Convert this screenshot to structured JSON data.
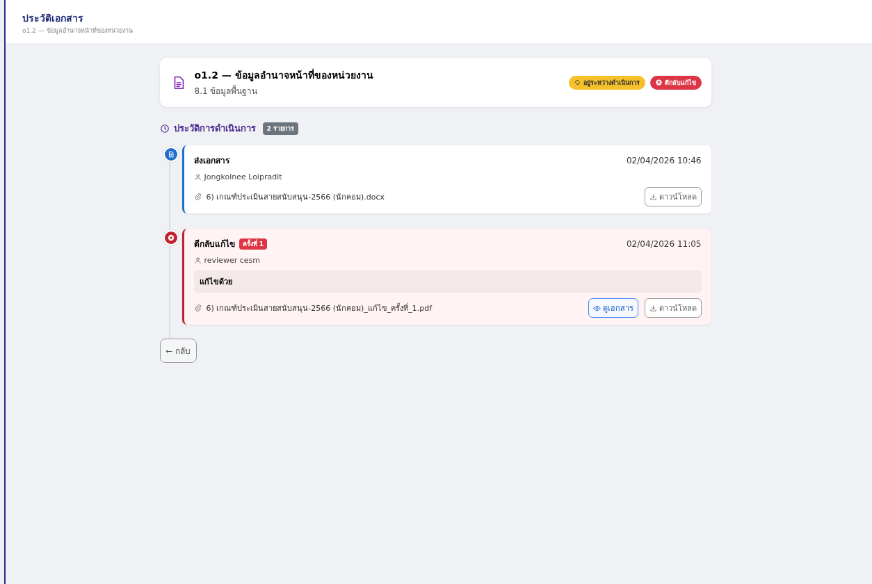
{
  "header": {
    "title": "ประวัติเอกสาร",
    "subtitle": "o1.2 — ข้อมูลอำนาจหน้าที่ของหน่วยงาน"
  },
  "document": {
    "title": "o1.2 — ข้อมูลอำนาจหน้าที่ของหน่วยงาน",
    "category": "8.1 ข้อมูลพื้นฐาน",
    "badges": [
      {
        "kind": "pending",
        "label": "อยู่ระหว่างดำเนินการ"
      },
      {
        "kind": "returned",
        "label": "ตีกลับแก้ไข"
      }
    ]
  },
  "history": {
    "title": "ประวัติการดำเนินการ",
    "count": "2 รายการ",
    "entries": [
      {
        "kind": "submit",
        "action": "ส่งเอกสาร",
        "timestamp": "02/04/2026 10:46",
        "user": "Jongkolnee Loipradit",
        "file": "6) เกณฑ์ประเมินสายสนับสนุน-2566 (นักคอม).docx",
        "buttons": [
          {
            "kind": "download",
            "label": "ดาวน์โหลด"
          }
        ]
      },
      {
        "kind": "return",
        "action": "ตีกลับแก้ไข",
        "round": "ครั้งที่ 1",
        "timestamp": "02/04/2026 11:05",
        "user": "reviewer cesm",
        "comment": "แก้ไขด้วย",
        "file": "6) เกณฑ์ประเมินสายสนับสนุน-2566 (นักคอม)_แก้ไข_ครั้งที่_1.pdf",
        "buttons": [
          {
            "kind": "view",
            "label": "ดูเอกสาร"
          },
          {
            "kind": "download",
            "label": "ดาวน์โหลด"
          }
        ]
      }
    ]
  },
  "back_button": {
    "label": "← กลับ"
  }
}
